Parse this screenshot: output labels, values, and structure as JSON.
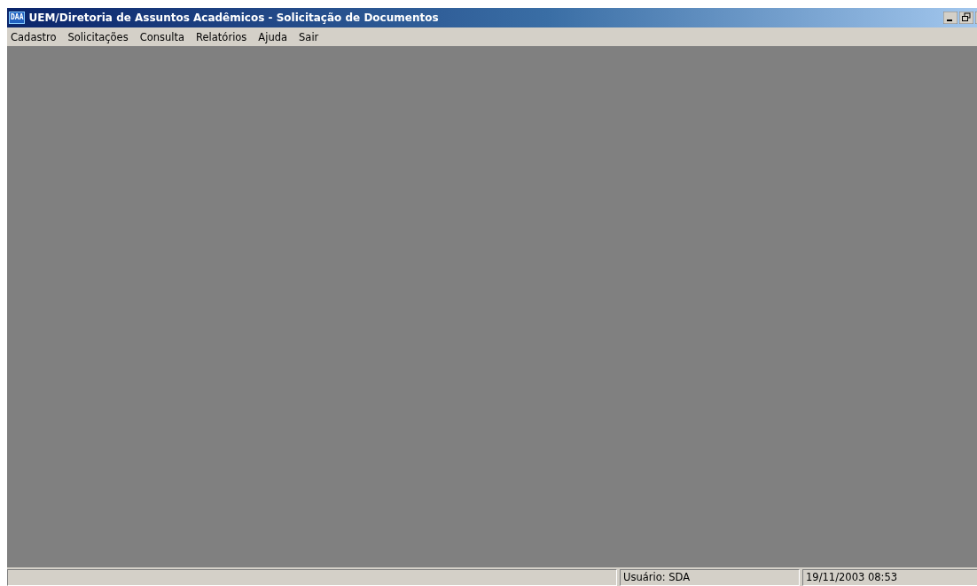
{
  "window": {
    "logo": "DAA",
    "title": "UEM/Diretoria de Assuntos Acadêmicos - Solicitação de Documentos"
  },
  "menu": [
    {
      "label": "Cadastro"
    },
    {
      "label": "Solicitações"
    },
    {
      "label": "Consulta"
    },
    {
      "label": "Relatórios"
    },
    {
      "label": "Ajuda"
    },
    {
      "label": "Sair"
    }
  ],
  "status_bar": {
    "user": "Usuário: SDA",
    "datetime": "19/11/2003 08:53"
  }
}
